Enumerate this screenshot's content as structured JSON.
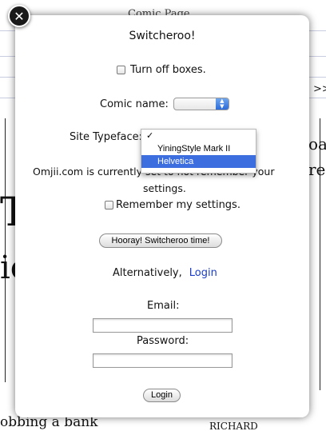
{
  "background": {
    "top_heading": "Comic Page",
    "next_symbol": ">>",
    "left_fragments": [
      "T",
      "ic"
    ],
    "right_fragments": [
      "oa",
      "re"
    ],
    "caption_left": "obbing a bank",
    "caption_right": "RICHARD"
  },
  "modal": {
    "close_symbol": "✕",
    "title": "Switcheroo!",
    "turn_off_boxes": {
      "label": "Turn off boxes.",
      "checked": false
    },
    "comic_name": {
      "label": "Comic name:",
      "value": ""
    },
    "site_typeface": {
      "label": "Site Typeface:",
      "options": [
        "",
        "YiningStyle Mark II",
        "Helvetica"
      ],
      "checked_index": 0,
      "highlighted_index": 2
    },
    "info_text_line1": "Omjii.com is currently set to not remember your",
    "info_text_line2": "settings.",
    "remember_settings": {
      "label": "Remember my settings.",
      "checked": false
    },
    "switch_button": "Hooray! Switcheroo time!",
    "alternatively": "Alternatively,",
    "login_link": "Login",
    "email_label": "Email:",
    "email_value": "",
    "password_label": "Password:",
    "password_value": "",
    "login_button": "Login"
  }
}
